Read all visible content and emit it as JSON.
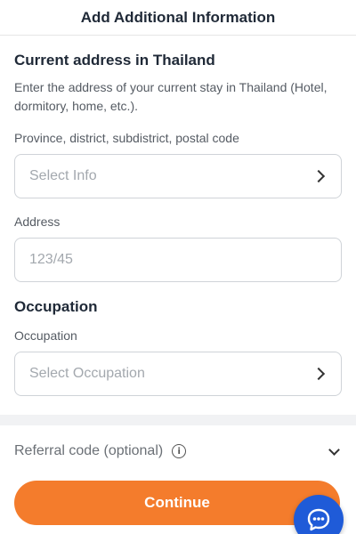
{
  "header": {
    "title": "Add Additional Information"
  },
  "address_section": {
    "title": "Current address in Thailand",
    "description": "Enter the address of your current stay in Thailand (Hotel, dormitory, home, etc.).",
    "location_field": {
      "label": "Province, district, subdistrict, postal code",
      "placeholder": "Select Info"
    },
    "address_field": {
      "label": "Address",
      "placeholder": "123/45"
    }
  },
  "occupation_section": {
    "title": "Occupation",
    "field": {
      "label": "Occupation",
      "placeholder": "Select Occupation"
    }
  },
  "referral": {
    "label": "Referral code (optional)"
  },
  "footer": {
    "continue_label": "Continue"
  },
  "colors": {
    "accent": "#f47c2c",
    "chat": "#1f5bd8"
  },
  "icons": [
    "chevron-right-icon",
    "info-icon",
    "chevron-down-icon",
    "chat-icon"
  ]
}
